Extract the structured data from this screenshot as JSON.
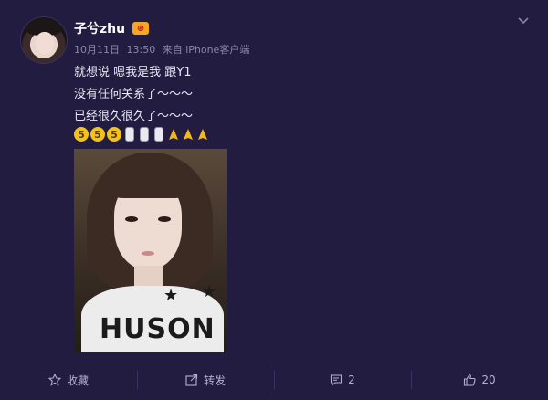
{
  "post": {
    "username": "子兮zhu",
    "vip_badge": "⊕",
    "meta": {
      "date": "10月11日",
      "time": "13:50",
      "source": "来自 iPhone客户端"
    },
    "lines": [
      "就想说 嗯我是我 跟Y1",
      "没有任何关系了～～～",
      "已经很久很久了～～～"
    ],
    "emoji_row": {
      "five_glyph": "5",
      "icons": [
        "five-emoji",
        "five-emoji",
        "five-emoji",
        "microphone-emoji",
        "microphone-emoji",
        "microphone-emoji",
        "pray-emoji",
        "pray-emoji",
        "pray-emoji"
      ]
    },
    "photo": {
      "shirt_print": "HUSON"
    }
  },
  "actions": {
    "favorite_label": "收藏",
    "forward_label": "转发",
    "comment_count": "2",
    "like_count": "20"
  },
  "colors": {
    "background": "#231c41",
    "text": "#e9e6f4",
    "meta": "#8c86a6",
    "divider": "#3a3260"
  }
}
